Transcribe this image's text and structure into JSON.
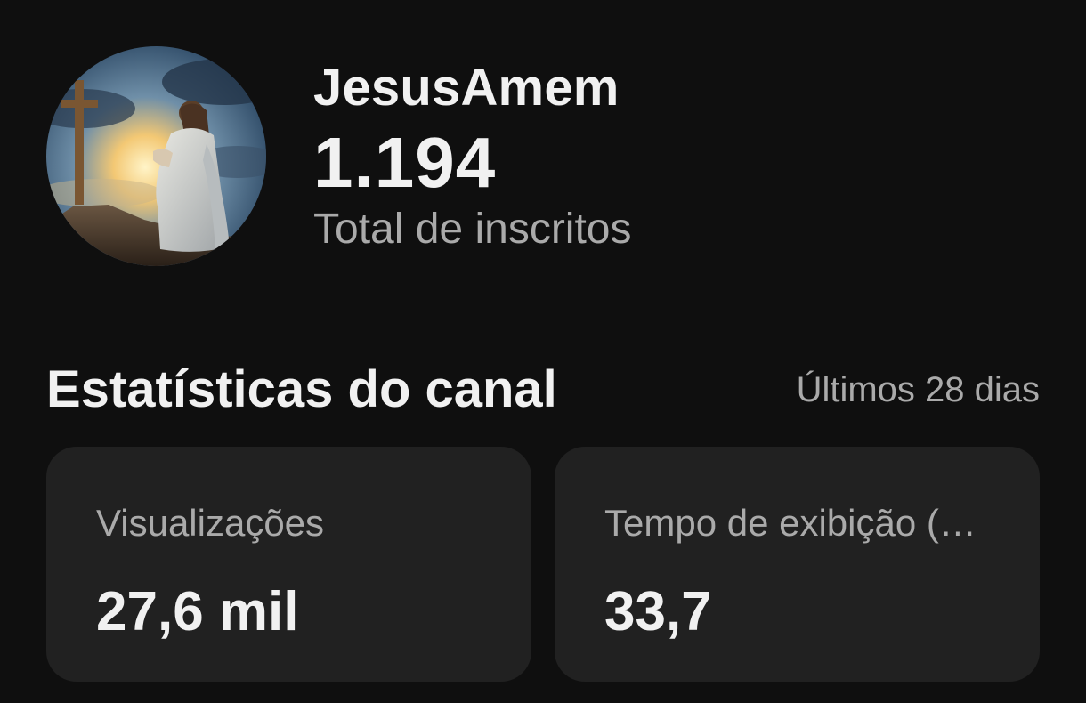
{
  "channel": {
    "name": "JesusAmem",
    "avatar_icon": "channel-avatar-praying-figure-cross",
    "subscriber_count": "1.194",
    "subscriber_label": "Total de inscritos"
  },
  "stats": {
    "title": "Estatísticas do canal",
    "period": "Últimos 28 dias",
    "cards": [
      {
        "label": "Visualizações",
        "value": "27,6 mil"
      },
      {
        "label": "Tempo de exibição (…",
        "value": "33,7"
      }
    ]
  },
  "colors": {
    "background": "#0f0f0f",
    "card_background": "#212121",
    "primary_text": "#f1f1f1",
    "secondary_text": "#aaaaaa"
  }
}
